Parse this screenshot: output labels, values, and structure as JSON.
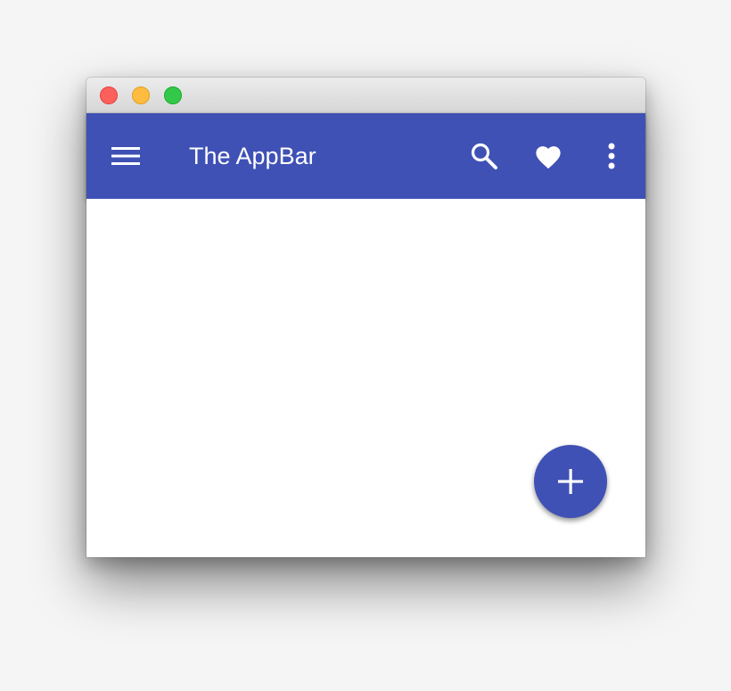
{
  "window": {
    "traffic_lights": [
      "close",
      "minimize",
      "maximize"
    ]
  },
  "appbar": {
    "title": "The AppBar",
    "background": "#3f51b5",
    "icons": {
      "menu": "menu-icon",
      "search": "search-icon",
      "favorite": "heart-icon",
      "more": "more-vert-icon"
    }
  },
  "fab": {
    "icon": "plus-icon",
    "color": "#3f51b5"
  }
}
